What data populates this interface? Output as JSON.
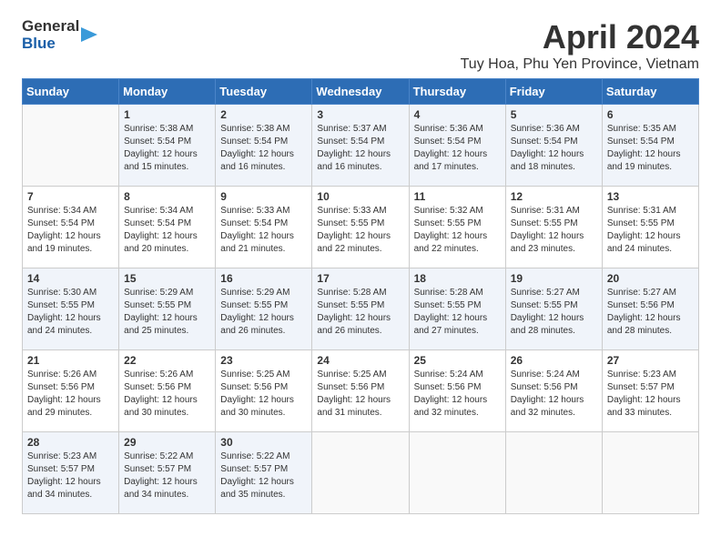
{
  "header": {
    "logo_line1": "General",
    "logo_line2": "Blue",
    "month_title": "April 2024",
    "location": "Tuy Hoa, Phu Yen Province, Vietnam"
  },
  "days_of_week": [
    "Sunday",
    "Monday",
    "Tuesday",
    "Wednesday",
    "Thursday",
    "Friday",
    "Saturday"
  ],
  "weeks": [
    [
      {
        "day": "",
        "info": ""
      },
      {
        "day": "1",
        "info": "Sunrise: 5:38 AM\nSunset: 5:54 PM\nDaylight: 12 hours\nand 15 minutes."
      },
      {
        "day": "2",
        "info": "Sunrise: 5:38 AM\nSunset: 5:54 PM\nDaylight: 12 hours\nand 16 minutes."
      },
      {
        "day": "3",
        "info": "Sunrise: 5:37 AM\nSunset: 5:54 PM\nDaylight: 12 hours\nand 16 minutes."
      },
      {
        "day": "4",
        "info": "Sunrise: 5:36 AM\nSunset: 5:54 PM\nDaylight: 12 hours\nand 17 minutes."
      },
      {
        "day": "5",
        "info": "Sunrise: 5:36 AM\nSunset: 5:54 PM\nDaylight: 12 hours\nand 18 minutes."
      },
      {
        "day": "6",
        "info": "Sunrise: 5:35 AM\nSunset: 5:54 PM\nDaylight: 12 hours\nand 19 minutes."
      }
    ],
    [
      {
        "day": "7",
        "info": "Sunrise: 5:34 AM\nSunset: 5:54 PM\nDaylight: 12 hours\nand 19 minutes."
      },
      {
        "day": "8",
        "info": "Sunrise: 5:34 AM\nSunset: 5:54 PM\nDaylight: 12 hours\nand 20 minutes."
      },
      {
        "day": "9",
        "info": "Sunrise: 5:33 AM\nSunset: 5:54 PM\nDaylight: 12 hours\nand 21 minutes."
      },
      {
        "day": "10",
        "info": "Sunrise: 5:33 AM\nSunset: 5:55 PM\nDaylight: 12 hours\nand 22 minutes."
      },
      {
        "day": "11",
        "info": "Sunrise: 5:32 AM\nSunset: 5:55 PM\nDaylight: 12 hours\nand 22 minutes."
      },
      {
        "day": "12",
        "info": "Sunrise: 5:31 AM\nSunset: 5:55 PM\nDaylight: 12 hours\nand 23 minutes."
      },
      {
        "day": "13",
        "info": "Sunrise: 5:31 AM\nSunset: 5:55 PM\nDaylight: 12 hours\nand 24 minutes."
      }
    ],
    [
      {
        "day": "14",
        "info": "Sunrise: 5:30 AM\nSunset: 5:55 PM\nDaylight: 12 hours\nand 24 minutes."
      },
      {
        "day": "15",
        "info": "Sunrise: 5:29 AM\nSunset: 5:55 PM\nDaylight: 12 hours\nand 25 minutes."
      },
      {
        "day": "16",
        "info": "Sunrise: 5:29 AM\nSunset: 5:55 PM\nDaylight: 12 hours\nand 26 minutes."
      },
      {
        "day": "17",
        "info": "Sunrise: 5:28 AM\nSunset: 5:55 PM\nDaylight: 12 hours\nand 26 minutes."
      },
      {
        "day": "18",
        "info": "Sunrise: 5:28 AM\nSunset: 5:55 PM\nDaylight: 12 hours\nand 27 minutes."
      },
      {
        "day": "19",
        "info": "Sunrise: 5:27 AM\nSunset: 5:55 PM\nDaylight: 12 hours\nand 28 minutes."
      },
      {
        "day": "20",
        "info": "Sunrise: 5:27 AM\nSunset: 5:56 PM\nDaylight: 12 hours\nand 28 minutes."
      }
    ],
    [
      {
        "day": "21",
        "info": "Sunrise: 5:26 AM\nSunset: 5:56 PM\nDaylight: 12 hours\nand 29 minutes."
      },
      {
        "day": "22",
        "info": "Sunrise: 5:26 AM\nSunset: 5:56 PM\nDaylight: 12 hours\nand 30 minutes."
      },
      {
        "day": "23",
        "info": "Sunrise: 5:25 AM\nSunset: 5:56 PM\nDaylight: 12 hours\nand 30 minutes."
      },
      {
        "day": "24",
        "info": "Sunrise: 5:25 AM\nSunset: 5:56 PM\nDaylight: 12 hours\nand 31 minutes."
      },
      {
        "day": "25",
        "info": "Sunrise: 5:24 AM\nSunset: 5:56 PM\nDaylight: 12 hours\nand 32 minutes."
      },
      {
        "day": "26",
        "info": "Sunrise: 5:24 AM\nSunset: 5:56 PM\nDaylight: 12 hours\nand 32 minutes."
      },
      {
        "day": "27",
        "info": "Sunrise: 5:23 AM\nSunset: 5:57 PM\nDaylight: 12 hours\nand 33 minutes."
      }
    ],
    [
      {
        "day": "28",
        "info": "Sunrise: 5:23 AM\nSunset: 5:57 PM\nDaylight: 12 hours\nand 34 minutes."
      },
      {
        "day": "29",
        "info": "Sunrise: 5:22 AM\nSunset: 5:57 PM\nDaylight: 12 hours\nand 34 minutes."
      },
      {
        "day": "30",
        "info": "Sunrise: 5:22 AM\nSunset: 5:57 PM\nDaylight: 12 hours\nand 35 minutes."
      },
      {
        "day": "",
        "info": ""
      },
      {
        "day": "",
        "info": ""
      },
      {
        "day": "",
        "info": ""
      },
      {
        "day": "",
        "info": ""
      }
    ]
  ]
}
